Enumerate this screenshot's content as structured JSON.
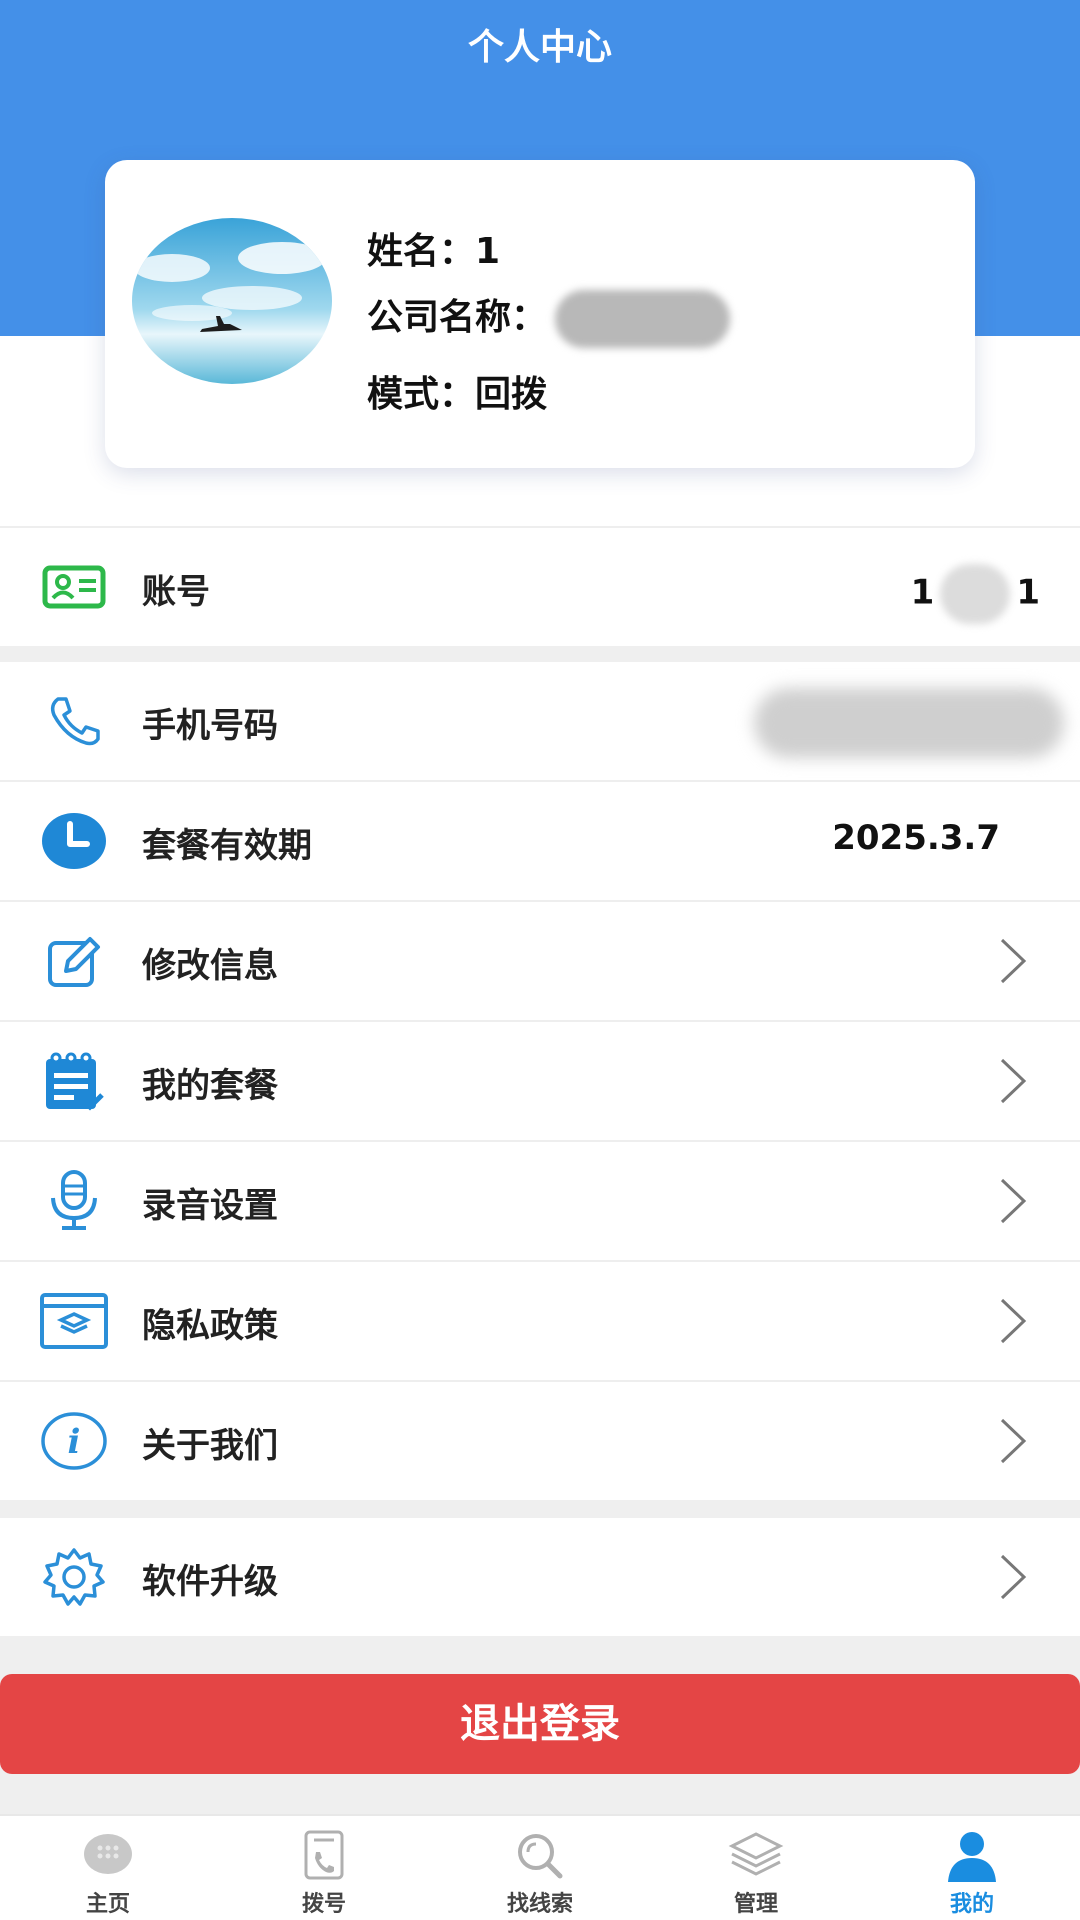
{
  "header": {
    "title": "个人中心"
  },
  "profile": {
    "name_label": "姓名：",
    "name_value": "1",
    "company_label": "公司名称：",
    "mode_label": "模式：",
    "mode_value": "回拨"
  },
  "rows": {
    "account": {
      "label": "账号",
      "value_start": "1",
      "value_end": "1",
      "icon": "id-card-icon"
    },
    "phone": {
      "label": "手机号码",
      "icon": "phone-icon"
    },
    "validity": {
      "label": "套餐有效期",
      "value": "2025.3.7",
      "icon": "clock-icon"
    },
    "edit": {
      "label": "修改信息",
      "icon": "edit-icon"
    },
    "plan": {
      "label": "我的套餐",
      "icon": "notepad-icon"
    },
    "recording": {
      "label": "录音设置",
      "icon": "microphone-icon"
    },
    "privacy": {
      "label": "隐私政策",
      "icon": "shield-window-icon"
    },
    "about": {
      "label": "关于我们",
      "icon": "info-icon"
    },
    "upgrade": {
      "label": "软件升级",
      "icon": "gear-icon"
    }
  },
  "logout": {
    "label": "退出登录"
  },
  "tabbar": {
    "items": [
      {
        "label": "主页",
        "icon": "home-icon"
      },
      {
        "label": "拨号",
        "icon": "dial-icon"
      },
      {
        "label": "找线索",
        "icon": "search-icon"
      },
      {
        "label": "管理",
        "icon": "layers-icon"
      },
      {
        "label": "我的",
        "icon": "user-icon",
        "active": true
      }
    ]
  },
  "colors": {
    "header": "#4490e8",
    "accent": "#1a8de0",
    "logout": "#e44545",
    "account_icon": "#2db84a"
  }
}
